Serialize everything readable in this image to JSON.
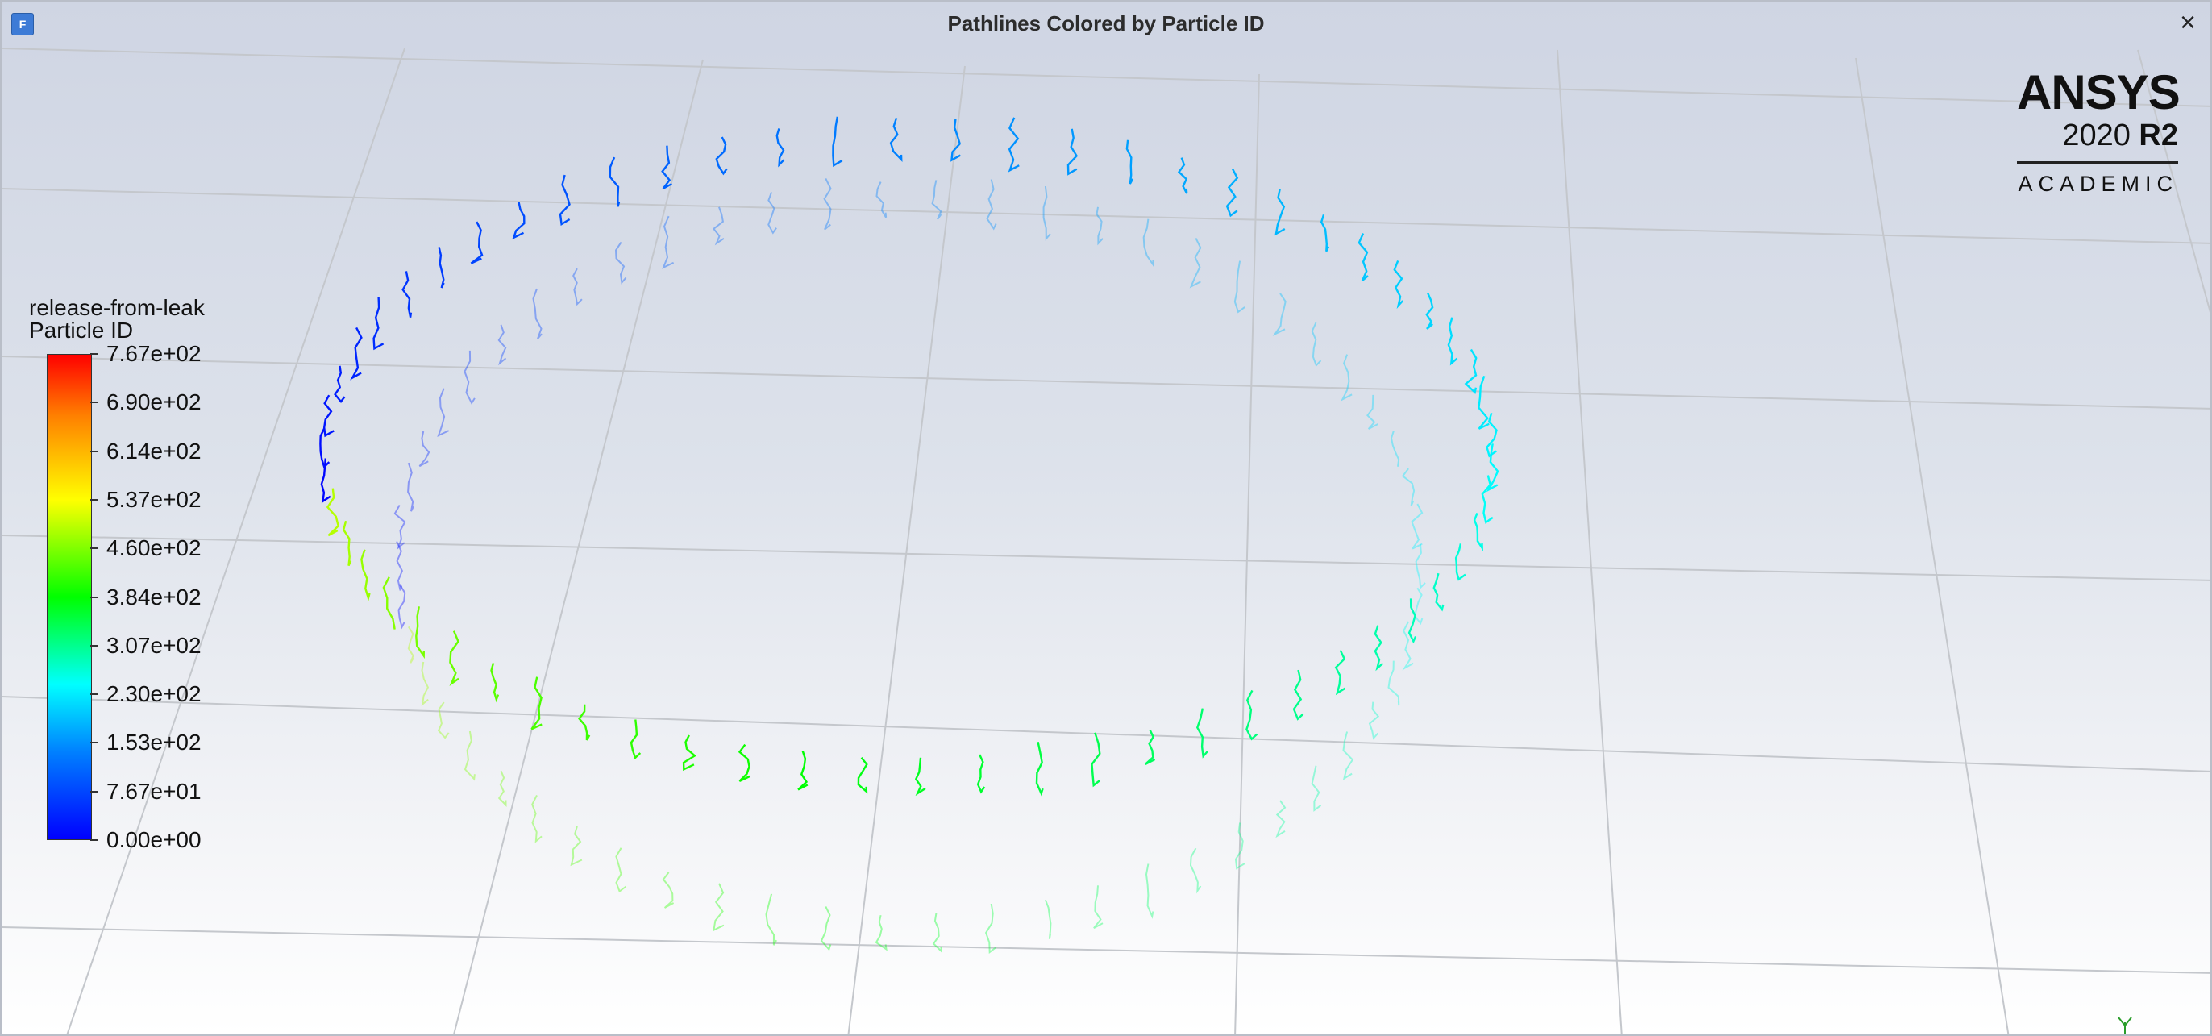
{
  "window": {
    "title": "Pathlines Colored by Particle ID",
    "close_label": "×",
    "icon": "fluent-app-icon"
  },
  "logo": {
    "brand": "ANSYS",
    "year": "2020",
    "release": "R2",
    "edition": "ACADEMIC"
  },
  "legend": {
    "title_line1": "release-from-leak",
    "title_line2": "Particle ID",
    "ticks": [
      "7.67e+02",
      "6.90e+02",
      "6.14e+02",
      "5.37e+02",
      "4.60e+02",
      "3.84e+02",
      "3.07e+02",
      "2.30e+02",
      "1.53e+02",
      "7.67e+01",
      "0.00e+00"
    ],
    "min": 0,
    "max": 767,
    "colormap": [
      "#0000ff",
      "#0080ff",
      "#00ffff",
      "#00ff00",
      "#ffff00",
      "#ff7f00",
      "#ff0000"
    ]
  },
  "scene": {
    "background_top": "#cfd5e3",
    "background_bottom": "#ffffff",
    "grid_color": "#c4c7cc"
  }
}
